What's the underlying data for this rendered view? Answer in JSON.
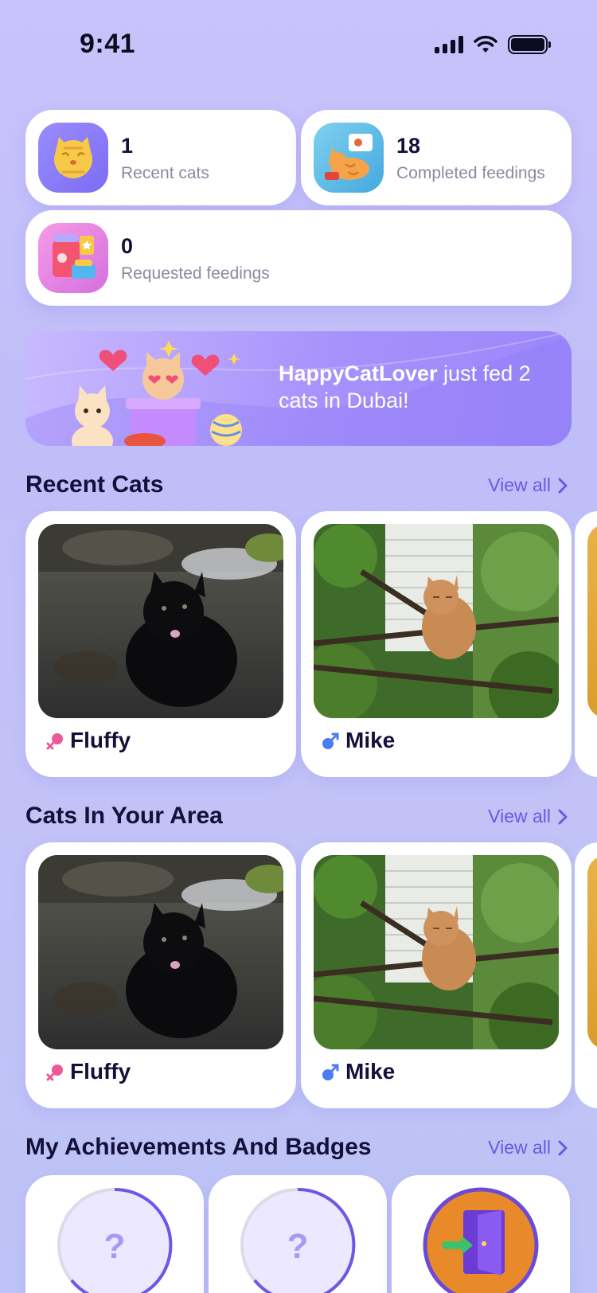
{
  "status_bar": {
    "time": "9:41"
  },
  "stats": [
    {
      "value": "1",
      "label": "Recent cats",
      "icon": "cat-face-icon"
    },
    {
      "value": "18",
      "label": "Completed feedings",
      "icon": "cat-feeding-icon"
    },
    {
      "value": "0",
      "label": "Requested feedings",
      "icon": "food-request-icon"
    }
  ],
  "banner": {
    "user": "HappyCatLover",
    "message": " just fed 2 cats in Dubai!"
  },
  "sections": {
    "recent": {
      "title": "Recent Cats",
      "view_all": "View all"
    },
    "area": {
      "title": "Cats In Your Area",
      "view_all": "View all"
    },
    "achievements": {
      "title": "My Achievements And Badges",
      "view_all": "View all"
    }
  },
  "recent_cats": [
    {
      "name": "Fluffy",
      "gender": "female"
    },
    {
      "name": "Mike",
      "gender": "male"
    }
  ],
  "area_cats": [
    {
      "name": "Fluffy",
      "gender": "female"
    },
    {
      "name": "Mike",
      "gender": "male"
    }
  ],
  "badges": [
    {
      "symbol": "?",
      "state": "locked"
    },
    {
      "symbol": "?",
      "state": "locked"
    },
    {
      "icon": "door-exit-icon",
      "state": "earned"
    }
  ],
  "colors": {
    "accent": "#6a58e6",
    "text_dark": "#14103a",
    "text_muted": "#8a8aa0",
    "female": "#f0569a",
    "male": "#4a7df0"
  }
}
